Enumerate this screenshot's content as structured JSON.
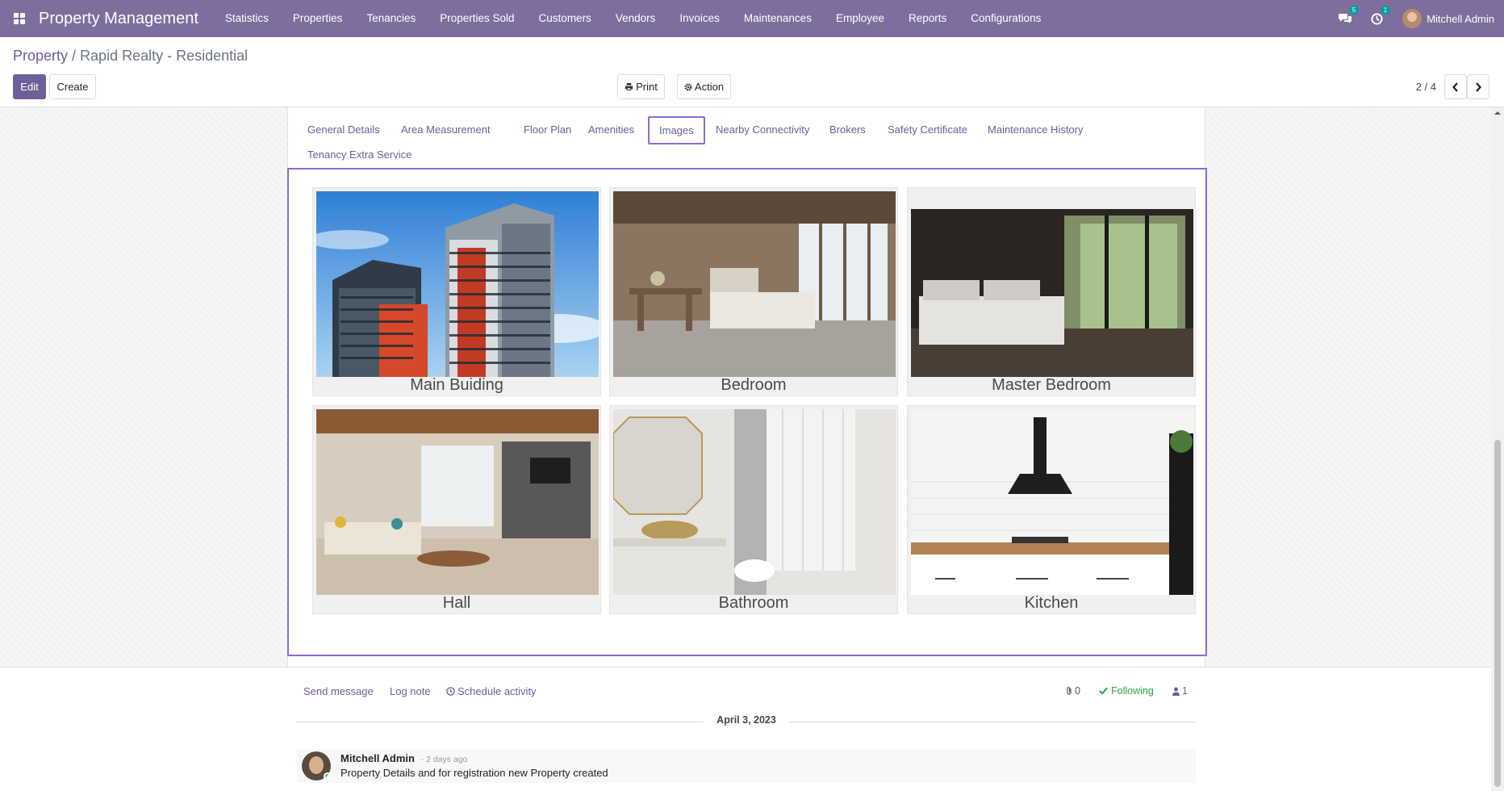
{
  "navbar": {
    "brand": "Property Management",
    "menu": [
      "Statistics",
      "Properties",
      "Tenancies",
      "Properties Sold",
      "Customers",
      "Vendors",
      "Invoices",
      "Maintenances",
      "Employee",
      "Reports",
      "Configurations"
    ],
    "messages_count": "5",
    "activities_count": "1",
    "user_name": "Mitchell Admin"
  },
  "breadcrumb": {
    "root": "Property",
    "current": "Rapid Realty - Residential"
  },
  "toolbar": {
    "edit": "Edit",
    "create": "Create",
    "print": "Print",
    "action": "Action"
  },
  "pager": {
    "value": "2 / 4"
  },
  "tabs": {
    "items": [
      "General Details",
      "Area Measurement",
      "Floor Plan",
      "Amenities",
      "Images",
      "Nearby Connectivity",
      "Brokers",
      "Safety Certificate",
      "Maintenance History",
      "Tenancy Extra Service"
    ],
    "active": "Images"
  },
  "images": [
    {
      "caption": "Main Buiding"
    },
    {
      "caption": "Bedroom"
    },
    {
      "caption": "Master Bedroom"
    },
    {
      "caption": "Hall"
    },
    {
      "caption": "Bathroom"
    },
    {
      "caption": "Kitchen"
    }
  ],
  "chatter": {
    "send_message": "Send message",
    "log_note": "Log note",
    "schedule_activity": "Schedule activity",
    "attachments_count": "0",
    "following": "Following",
    "followers_count": "1",
    "date": "April 3, 2023",
    "message": {
      "author": "Mitchell Admin",
      "time": "- 2 days ago",
      "body": "Property Details and for registration new Property created"
    }
  },
  "colors": {
    "navbar": "#7e6e9f",
    "primary": "#6f5f98",
    "active_tab_border": "#8f6bd6",
    "following": "#28a745"
  }
}
